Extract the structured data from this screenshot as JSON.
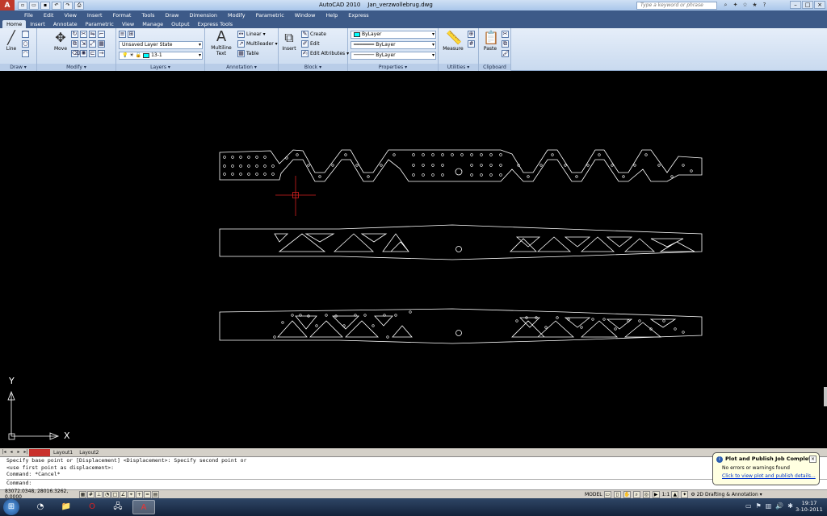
{
  "titlebar": {
    "app_name": "AutoCAD 2010",
    "file_name": "Jan_verzwollebrug.dwg",
    "search_placeholder": "Type a keyword or phrase"
  },
  "menu": [
    "File",
    "Edit",
    "View",
    "Insert",
    "Format",
    "Tools",
    "Draw",
    "Dimension",
    "Modify",
    "Parametric",
    "Window",
    "Help",
    "Express"
  ],
  "tabs": [
    "Home",
    "Insert",
    "Annotate",
    "Parametric",
    "View",
    "Manage",
    "Output",
    "Express Tools"
  ],
  "ribbon": {
    "draw": {
      "title": "Draw",
      "line_label": "Line"
    },
    "modify": {
      "title": "Modify",
      "move_label": "Move"
    },
    "layers": {
      "title": "Layers",
      "layer_state": "Unsaved Layer State",
      "current_layer": "13-1"
    },
    "annotation": {
      "title": "Annotation",
      "multiline_text": "Multiline\nText",
      "multiline_label": "Multiline",
      "text_label": "Text",
      "linear": "Linear",
      "multileader": "Multileader",
      "table": "Table"
    },
    "block": {
      "title": "Block",
      "insert": "Insert",
      "create": "Create",
      "edit": "Edit",
      "edit_attributes": "Edit Attributes"
    },
    "properties": {
      "title": "Properties",
      "color": "ByLayer",
      "lineweight": "ByLayer",
      "linetype": "ByLayer"
    },
    "utilities": {
      "title": "Utilities",
      "measure": "Measure"
    },
    "clipboard": {
      "title": "Clipboard",
      "paste": "Paste"
    }
  },
  "layout_tabs": [
    "Model",
    "Layout1",
    "Layout2"
  ],
  "ucs": {
    "x_label": "X",
    "y_label": "Y"
  },
  "command_history": [
    "Specify base point or [Displacement] <Displacement>: Specify second point or",
    "<use first point as displacement>:",
    "Command: *Cancel*"
  ],
  "command_prompt": "Command:",
  "status": {
    "coords": "83072.0348, 28016.3262, 0.0000",
    "model": "MODEL",
    "scale": "1:1",
    "workspace": "2D Drafting & Annotation"
  },
  "notification": {
    "title": "Plot and Publish Job Complete",
    "message": "No errors or warnings found",
    "link": "Click to view plot and publish details..."
  },
  "clock": {
    "time": "19:17",
    "date": "3-10-2011"
  },
  "colors": {
    "drawing_lines": "#ffffff",
    "crosshair": "#d42020",
    "layer_color": "#00ffff",
    "canvas": "#000000"
  }
}
